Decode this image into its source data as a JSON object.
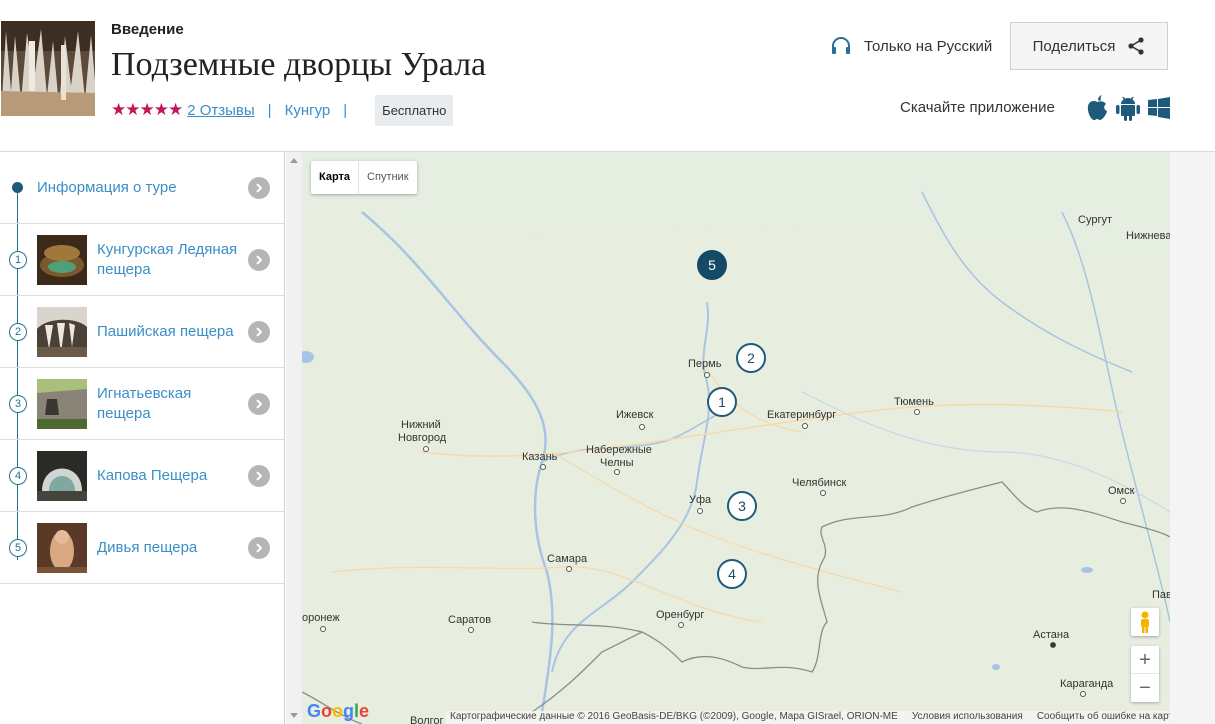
{
  "header": {
    "subtitle": "Введение",
    "title": "Подземные дворцы Урала",
    "stars": "★★★★★",
    "reviews": "2 Отзывы",
    "separator": "|",
    "city": "Кунгур",
    "price_badge": "Бесплатно",
    "language": "Только на Русский",
    "share": "Поделиться",
    "download": "Скачайте приложение",
    "store_icons": [
      "apple-icon",
      "android-icon",
      "windows-icon"
    ],
    "accent_color": "#c2185b",
    "link_color": "#3a8fc7"
  },
  "sidebar": {
    "info": "Информация о туре",
    "items": [
      {
        "num": "1",
        "label": "Кунгурская Ледяная пещера"
      },
      {
        "num": "2",
        "label": "Пашийская пещера"
      },
      {
        "num": "3",
        "label": "Игнатьевская пещера"
      },
      {
        "num": "4",
        "label": "Капова Пещера"
      },
      {
        "num": "5",
        "label": "Дивья пещера"
      }
    ]
  },
  "map": {
    "type_map": "Карта",
    "type_satellite": "Спутник",
    "cities": {
      "surgut": "Сургут",
      "nizhnevartovsk": "Нижнева",
      "perm": "Пермь",
      "izhevsk": "Ижевск",
      "yekaterinburg": "Екатеринбург",
      "tyumen": "Тюмень",
      "nizhny1": "Нижний",
      "nizhny2": "Новгород",
      "naber1": "Набережные",
      "naber2": "Челны",
      "kazan": "Казань",
      "chelyabinsk": "Челябинск",
      "omsk": "Омск",
      "ufa": "Уфа",
      "samara": "Самара",
      "orenburg": "Оренбург",
      "voronezh": "оронеж",
      "saratov": "Саратов",
      "astana": "Астана",
      "karaganda": "Караганда",
      "pavlodar": "Пав",
      "volgograd": "Волгог"
    },
    "markers": [
      "1",
      "2",
      "3",
      "4",
      "5"
    ],
    "zoom_in": "+",
    "zoom_out": "−",
    "google": "Google",
    "attribution": "Картографические данные © 2016 GeoBasis-DE/BKG (©2009), Google, Mapa GISrael, ORION-ME",
    "terms": "Условия использования",
    "report": "Сообщить об ошибке на карте"
  }
}
